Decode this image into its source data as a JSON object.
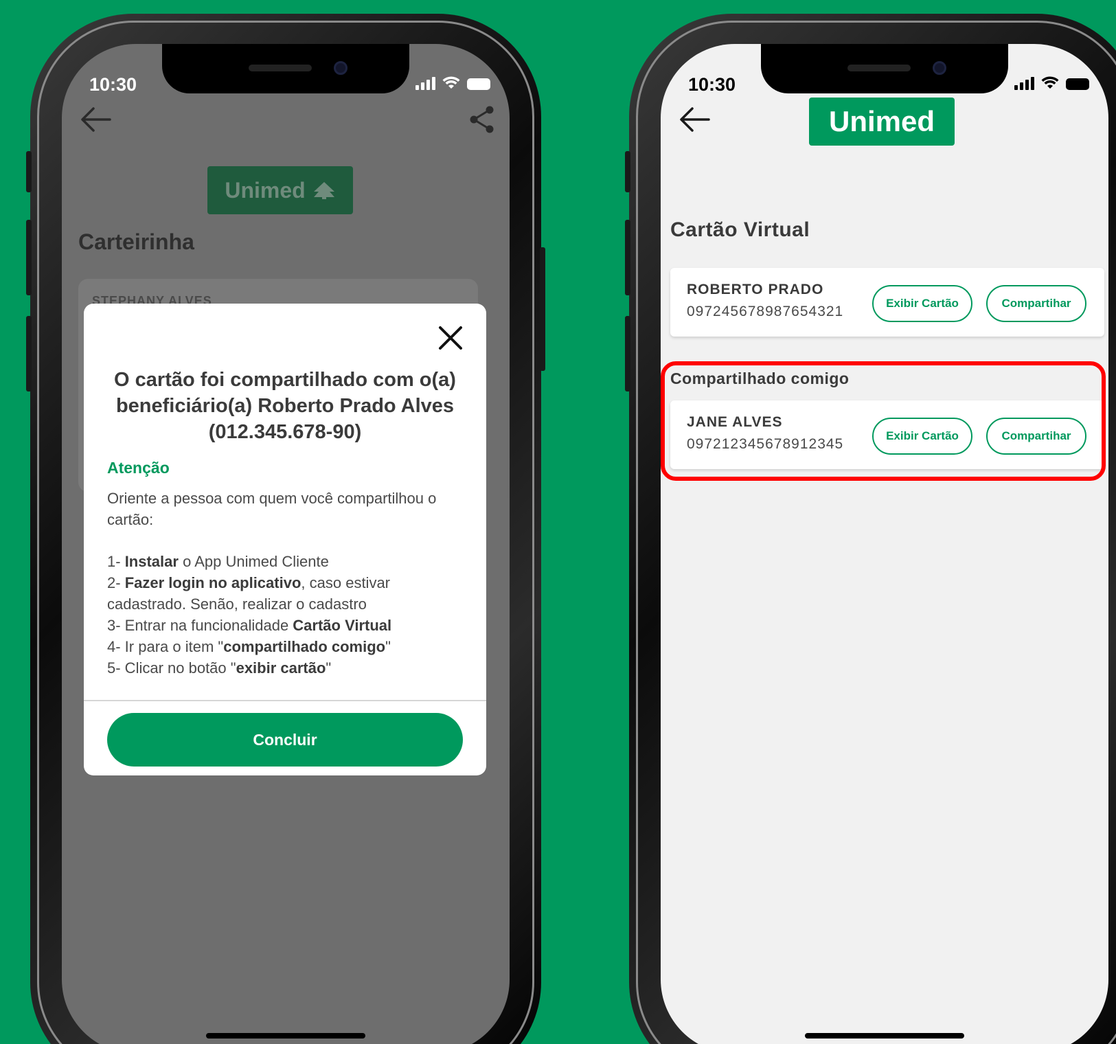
{
  "colors": {
    "brand_green": "#00995D",
    "highlight_red": "#ff0000"
  },
  "left_phone": {
    "status_time": "10:30",
    "header": {
      "back_icon": "arrow-left-icon",
      "share_icon": "share-icon"
    },
    "logo_text": "Unimed",
    "page_title": "Carteirinha",
    "background_card_name": "STEPHANY ALVES",
    "modal": {
      "title": "O cartão foi compartilhado com o(a) beneficiário(a) Roberto Prado Alves (012.345.678-90)",
      "attention_label": "Atenção",
      "orient_text": "Oriente a pessoa com quem você compartilhou o cartão:",
      "steps": [
        {
          "num": "1-",
          "bold": "Instalar",
          "text": " o App Unimed Cliente"
        },
        {
          "num": "2-",
          "bold": "Fazer login no aplicativo",
          "text": ", caso estivar cadastrado. Senão, realizar o cadastro"
        },
        {
          "num": "3-",
          "pre": " Entrar na funcionalidade ",
          "bold": "Cartão Virtual"
        },
        {
          "num": "4-",
          "pre": " Ir para o item \"",
          "bold": "compartilhado comigo",
          "text": "\""
        },
        {
          "num": "5-",
          "pre": " Clicar no botão \"",
          "bold": "exibir cartão",
          "text": "\""
        }
      ],
      "confirm_label": "Concluir"
    }
  },
  "right_phone": {
    "status_time": "10:30",
    "logo_text": "Unimed",
    "page_title": "Cartão Virtual",
    "cards": [
      {
        "name": "ROBERTO PRADO",
        "number": "097245678987654321",
        "view_label": "Exibir Cartão",
        "share_label": "Compartihar"
      }
    ],
    "shared_section": {
      "title": "Compartilhado comigo",
      "cards": [
        {
          "name": "JANE ALVES",
          "number": "097212345678912345",
          "view_label": "Exibir Cartão",
          "share_label": "Compartihar"
        }
      ]
    }
  }
}
